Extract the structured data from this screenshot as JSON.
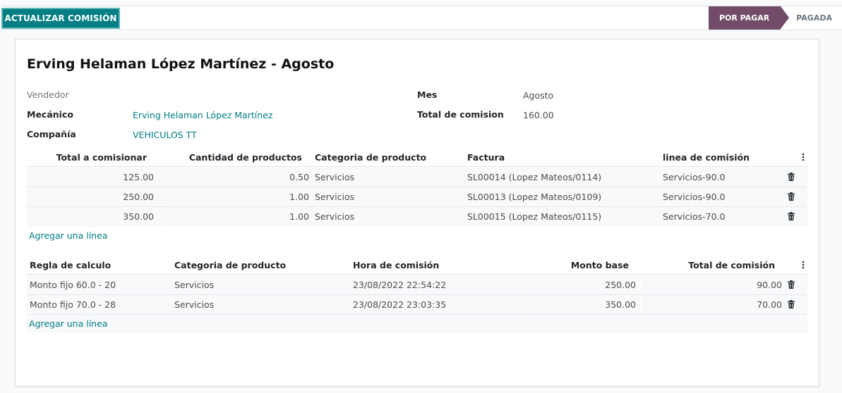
{
  "toolbar": {
    "update_label": "ACTUALIZAR COMISIÓN"
  },
  "statusbar": {
    "active": "POR PAGAR",
    "next": "PAGADA"
  },
  "record": {
    "title": "Erving Helaman López Martínez - Agosto",
    "vendedor_label": "Vendedor",
    "mecanico_label": "Mecánico",
    "mecanico_value": "Erving Helaman López Martínez",
    "compania_label": "Compañía",
    "compania_value": "VEHICULOS TT",
    "mes_label": "Mes",
    "mes_value": "Agosto",
    "total_label": "Total de comision",
    "total_value": "160.00"
  },
  "lines_table": {
    "headers": [
      "Total a comisionar",
      "Cantidad de productos",
      "Categoria de producto",
      "Factura",
      "linea de comisión"
    ],
    "rows": [
      [
        "125.00",
        "0.50",
        "Servicios",
        "SL00014 (Lopez Mateos/0114)",
        "Servicios-90.0"
      ],
      [
        "250.00",
        "1.00",
        "Servicios",
        "SL00013 (Lopez Mateos/0109)",
        "Servicios-90.0"
      ],
      [
        "350.00",
        "1.00",
        "Servicios",
        "SL00015 (Lopez Mateos/0115)",
        "Servicios-70.0"
      ]
    ],
    "add_line": "Agregar una línea"
  },
  "rules_table": {
    "headers": [
      "Regla de calculo",
      "Categoria de producto",
      "Hora de comisión",
      "Monto base",
      "Total de comisión"
    ],
    "rows": [
      [
        "Monto fijo 60.0 - 20",
        "Servicios",
        "23/08/2022 22:54:22",
        "250.00",
        "90.00"
      ],
      [
        "Monto fijo 70.0 - 28",
        "Servicios",
        "23/08/2022 23:03:35",
        "350.00",
        "70.00"
      ]
    ],
    "add_line": "Agregar una línea"
  },
  "colors": {
    "primary": "#017e84",
    "status_active": "#714b67"
  },
  "icons": [
    "trash-icon",
    "kebab-menu-icon"
  ]
}
